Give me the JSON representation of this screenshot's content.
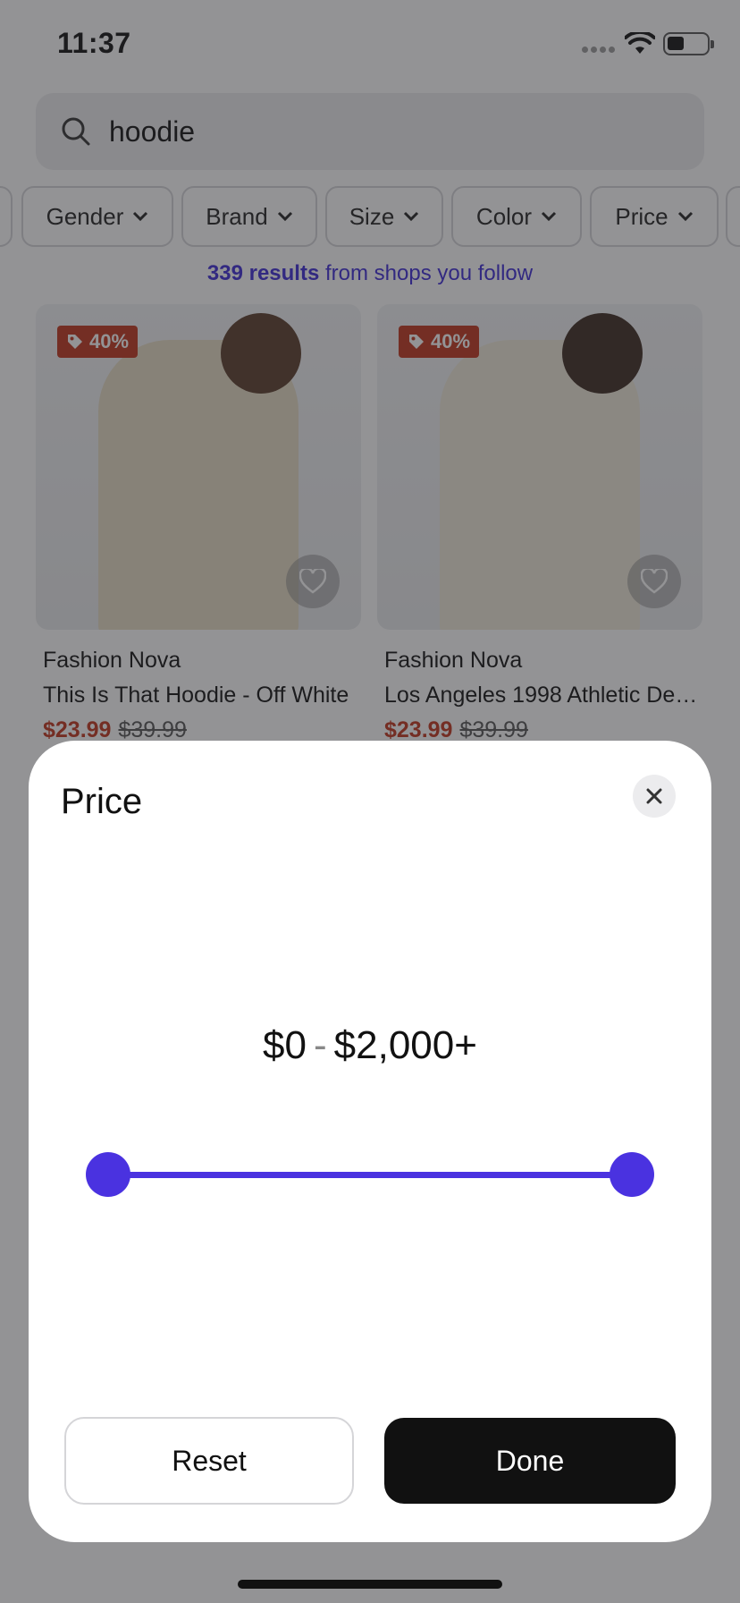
{
  "status_bar": {
    "time": "11:37"
  },
  "search": {
    "query": "hoodie"
  },
  "filters": {
    "chips": [
      {
        "label": "Gender"
      },
      {
        "label": "Brand"
      },
      {
        "label": "Size"
      },
      {
        "label": "Color"
      },
      {
        "label": "Price"
      }
    ]
  },
  "results": {
    "count_bold": "339 results",
    "suffix": "from shops you follow"
  },
  "products": [
    {
      "discount": "40%",
      "brand": "Fashion Nova",
      "name": "This Is That Hoodie - Off White",
      "sale_price": "$23.99",
      "original_price": "$39.99"
    },
    {
      "discount": "40%",
      "brand": "Fashion Nova",
      "name": "Los Angeles 1998 Athletic De…",
      "sale_price": "$23.99",
      "original_price": "$39.99"
    }
  ],
  "price_sheet": {
    "title": "Price",
    "min_label": "$0",
    "separator": "-",
    "max_label": "$2,000+",
    "range_min_fraction": 0,
    "range_max_fraction": 1,
    "accent_color": "#4a32e0",
    "reset_label": "Reset",
    "done_label": "Done"
  },
  "icons": {
    "search": "search-icon",
    "chevron": "chevron-down-icon",
    "tag": "tag-icon",
    "heart": "heart-icon",
    "close": "close-icon",
    "wifi": "wifi-icon",
    "battery": "battery-icon",
    "signal": "cellular-signal-icon"
  }
}
